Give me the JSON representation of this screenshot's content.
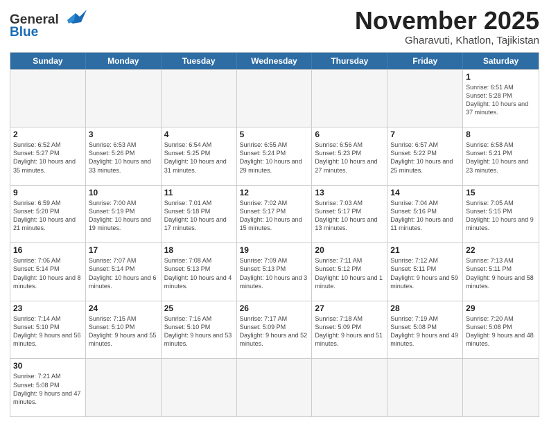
{
  "logo": {
    "line1": "General",
    "line2": "Blue"
  },
  "header": {
    "title": "November 2025",
    "location": "Gharavuti, Khatlon, Tajikistan"
  },
  "weekdays": [
    "Sunday",
    "Monday",
    "Tuesday",
    "Wednesday",
    "Thursday",
    "Friday",
    "Saturday"
  ],
  "weeks": [
    [
      {
        "day": "",
        "empty": true
      },
      {
        "day": "",
        "empty": true
      },
      {
        "day": "",
        "empty": true
      },
      {
        "day": "",
        "empty": true
      },
      {
        "day": "",
        "empty": true
      },
      {
        "day": "",
        "empty": true
      },
      {
        "day": "1",
        "info": "Sunrise: 6:51 AM\nSunset: 5:28 PM\nDaylight: 10 hours\nand 37 minutes."
      }
    ],
    [
      {
        "day": "2",
        "info": "Sunrise: 6:52 AM\nSunset: 5:27 PM\nDaylight: 10 hours\nand 35 minutes."
      },
      {
        "day": "3",
        "info": "Sunrise: 6:53 AM\nSunset: 5:26 PM\nDaylight: 10 hours\nand 33 minutes."
      },
      {
        "day": "4",
        "info": "Sunrise: 6:54 AM\nSunset: 5:25 PM\nDaylight: 10 hours\nand 31 minutes."
      },
      {
        "day": "5",
        "info": "Sunrise: 6:55 AM\nSunset: 5:24 PM\nDaylight: 10 hours\nand 29 minutes."
      },
      {
        "day": "6",
        "info": "Sunrise: 6:56 AM\nSunset: 5:23 PM\nDaylight: 10 hours\nand 27 minutes."
      },
      {
        "day": "7",
        "info": "Sunrise: 6:57 AM\nSunset: 5:22 PM\nDaylight: 10 hours\nand 25 minutes."
      },
      {
        "day": "8",
        "info": "Sunrise: 6:58 AM\nSunset: 5:21 PM\nDaylight: 10 hours\nand 23 minutes."
      }
    ],
    [
      {
        "day": "9",
        "info": "Sunrise: 6:59 AM\nSunset: 5:20 PM\nDaylight: 10 hours\nand 21 minutes."
      },
      {
        "day": "10",
        "info": "Sunrise: 7:00 AM\nSunset: 5:19 PM\nDaylight: 10 hours\nand 19 minutes."
      },
      {
        "day": "11",
        "info": "Sunrise: 7:01 AM\nSunset: 5:18 PM\nDaylight: 10 hours\nand 17 minutes."
      },
      {
        "day": "12",
        "info": "Sunrise: 7:02 AM\nSunset: 5:17 PM\nDaylight: 10 hours\nand 15 minutes."
      },
      {
        "day": "13",
        "info": "Sunrise: 7:03 AM\nSunset: 5:17 PM\nDaylight: 10 hours\nand 13 minutes."
      },
      {
        "day": "14",
        "info": "Sunrise: 7:04 AM\nSunset: 5:16 PM\nDaylight: 10 hours\nand 11 minutes."
      },
      {
        "day": "15",
        "info": "Sunrise: 7:05 AM\nSunset: 5:15 PM\nDaylight: 10 hours\nand 9 minutes."
      }
    ],
    [
      {
        "day": "16",
        "info": "Sunrise: 7:06 AM\nSunset: 5:14 PM\nDaylight: 10 hours\nand 8 minutes."
      },
      {
        "day": "17",
        "info": "Sunrise: 7:07 AM\nSunset: 5:14 PM\nDaylight: 10 hours\nand 6 minutes."
      },
      {
        "day": "18",
        "info": "Sunrise: 7:08 AM\nSunset: 5:13 PM\nDaylight: 10 hours\nand 4 minutes."
      },
      {
        "day": "19",
        "info": "Sunrise: 7:09 AM\nSunset: 5:13 PM\nDaylight: 10 hours\nand 3 minutes."
      },
      {
        "day": "20",
        "info": "Sunrise: 7:11 AM\nSunset: 5:12 PM\nDaylight: 10 hours\nand 1 minute."
      },
      {
        "day": "21",
        "info": "Sunrise: 7:12 AM\nSunset: 5:11 PM\nDaylight: 9 hours\nand 59 minutes."
      },
      {
        "day": "22",
        "info": "Sunrise: 7:13 AM\nSunset: 5:11 PM\nDaylight: 9 hours\nand 58 minutes."
      }
    ],
    [
      {
        "day": "23",
        "info": "Sunrise: 7:14 AM\nSunset: 5:10 PM\nDaylight: 9 hours\nand 56 minutes."
      },
      {
        "day": "24",
        "info": "Sunrise: 7:15 AM\nSunset: 5:10 PM\nDaylight: 9 hours\nand 55 minutes."
      },
      {
        "day": "25",
        "info": "Sunrise: 7:16 AM\nSunset: 5:10 PM\nDaylight: 9 hours\nand 53 minutes."
      },
      {
        "day": "26",
        "info": "Sunrise: 7:17 AM\nSunset: 5:09 PM\nDaylight: 9 hours\nand 52 minutes."
      },
      {
        "day": "27",
        "info": "Sunrise: 7:18 AM\nSunset: 5:09 PM\nDaylight: 9 hours\nand 51 minutes."
      },
      {
        "day": "28",
        "info": "Sunrise: 7:19 AM\nSunset: 5:08 PM\nDaylight: 9 hours\nand 49 minutes."
      },
      {
        "day": "29",
        "info": "Sunrise: 7:20 AM\nSunset: 5:08 PM\nDaylight: 9 hours\nand 48 minutes."
      }
    ],
    [
      {
        "day": "30",
        "info": "Sunrise: 7:21 AM\nSunset: 5:08 PM\nDaylight: 9 hours\nand 47 minutes."
      },
      {
        "day": "",
        "empty": true
      },
      {
        "day": "",
        "empty": true
      },
      {
        "day": "",
        "empty": true
      },
      {
        "day": "",
        "empty": true
      },
      {
        "day": "",
        "empty": true
      },
      {
        "day": "",
        "empty": true
      }
    ]
  ]
}
